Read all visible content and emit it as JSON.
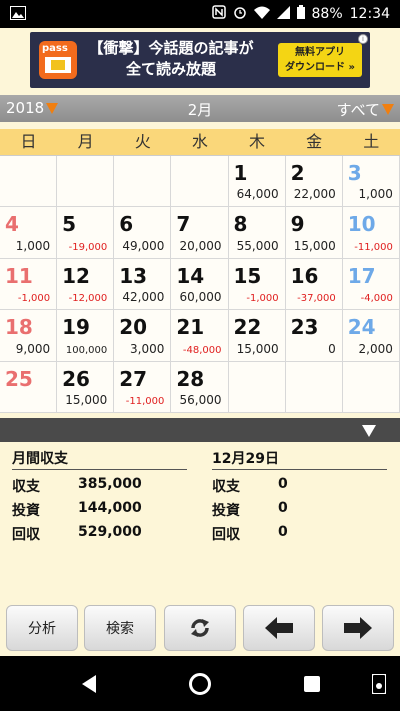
{
  "status": {
    "battery": "88%",
    "time": "12:34"
  },
  "ad": {
    "logo_text": "pass",
    "line1": "【衝撃】今話題の記事が",
    "line2": "全て読み放題",
    "cta_line1": "無料アプリ",
    "cta_line2": "ダウンロード »",
    "info": "i"
  },
  "nav": {
    "year": "2018",
    "month": "2月",
    "filter": "すべて"
  },
  "weekdays": [
    "日",
    "月",
    "火",
    "水",
    "木",
    "金",
    "土"
  ],
  "calendar": [
    {
      "day": "",
      "value": ""
    },
    {
      "day": "",
      "value": ""
    },
    {
      "day": "",
      "value": ""
    },
    {
      "day": "",
      "value": ""
    },
    {
      "day": "1",
      "value": "64,000"
    },
    {
      "day": "2",
      "value": "22,000"
    },
    {
      "day": "3",
      "value": "1,000"
    },
    {
      "day": "4",
      "value": "1,000"
    },
    {
      "day": "5",
      "value": "-19,000"
    },
    {
      "day": "6",
      "value": "49,000"
    },
    {
      "day": "7",
      "value": "20,000"
    },
    {
      "day": "8",
      "value": "55,000"
    },
    {
      "day": "9",
      "value": "15,000"
    },
    {
      "day": "10",
      "value": "-11,000"
    },
    {
      "day": "11",
      "value": "-1,000"
    },
    {
      "day": "12",
      "value": "-12,000"
    },
    {
      "day": "13",
      "value": "42,000"
    },
    {
      "day": "14",
      "value": "60,000"
    },
    {
      "day": "15",
      "value": "-1,000"
    },
    {
      "day": "16",
      "value": "-37,000"
    },
    {
      "day": "17",
      "value": "-4,000"
    },
    {
      "day": "18",
      "value": "9,000"
    },
    {
      "day": "19",
      "value": "100,000"
    },
    {
      "day": "20",
      "value": "3,000"
    },
    {
      "day": "21",
      "value": "-48,000"
    },
    {
      "day": "22",
      "value": "15,000"
    },
    {
      "day": "23",
      "value": "0"
    },
    {
      "day": "24",
      "value": "2,000"
    },
    {
      "day": "25",
      "value": ""
    },
    {
      "day": "26",
      "value": "15,000"
    },
    {
      "day": "27",
      "value": "-11,000"
    },
    {
      "day": "28",
      "value": "56,000"
    },
    {
      "day": "",
      "value": ""
    },
    {
      "day": "",
      "value": ""
    },
    {
      "day": "",
      "value": ""
    }
  ],
  "summary_month": {
    "title": "月間収支",
    "rows": [
      {
        "label": "収支",
        "value": "385,000"
      },
      {
        "label": "投資",
        "value": "144,000"
      },
      {
        "label": "回収",
        "value": "529,000"
      }
    ]
  },
  "summary_day": {
    "title": "12月29日",
    "rows": [
      {
        "label": "収支",
        "value": "0"
      },
      {
        "label": "投資",
        "value": "0"
      },
      {
        "label": "回収",
        "value": "0"
      }
    ]
  },
  "toolbar": {
    "analysis": "分析",
    "search": "検索",
    "sync_icon": "sync-icon",
    "prev_icon": "arrow-left-icon",
    "next_icon": "arrow-right-icon"
  },
  "colors": {
    "accent_orange": "#f07f10",
    "sunday": "#e96f6f",
    "saturday": "#6ea9e8",
    "negative": "#e02020",
    "header_yellow": "#fad77a"
  }
}
